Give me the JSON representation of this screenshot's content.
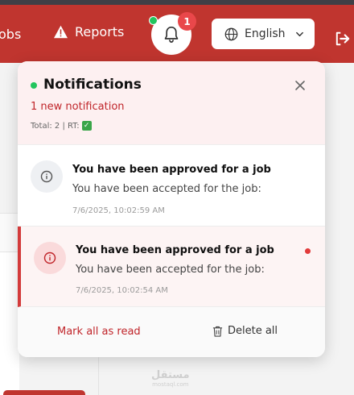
{
  "header": {
    "nav_jobs_label": "obs",
    "nav_reports_label": "Reports",
    "notification_badge": "1",
    "language_label": "English"
  },
  "watermark": {
    "text": "مستقل",
    "sub": "mostaql.com"
  },
  "notifications": {
    "title": "Notifications",
    "new_count": "1 new notification",
    "total_line": "Total: 2 | RT:",
    "items": [
      {
        "title": "You have been approved for a job",
        "body": "You have been accepted for the job:",
        "time": "7/6/2025, 10:02:59 AM",
        "unread": false
      },
      {
        "title": "You have been approved for a job",
        "body": "You have been accepted for the job:",
        "time": "7/6/2025, 10:02:54 AM",
        "unread": true
      }
    ],
    "mark_all_label": "Mark all as read",
    "delete_all_label": "Delete all"
  },
  "colors": {
    "brand_red": "#c0352f",
    "accent_red_text": "#c0252a",
    "online_green": "#22c55e",
    "panel_head_bg": "#fdf0f1"
  }
}
